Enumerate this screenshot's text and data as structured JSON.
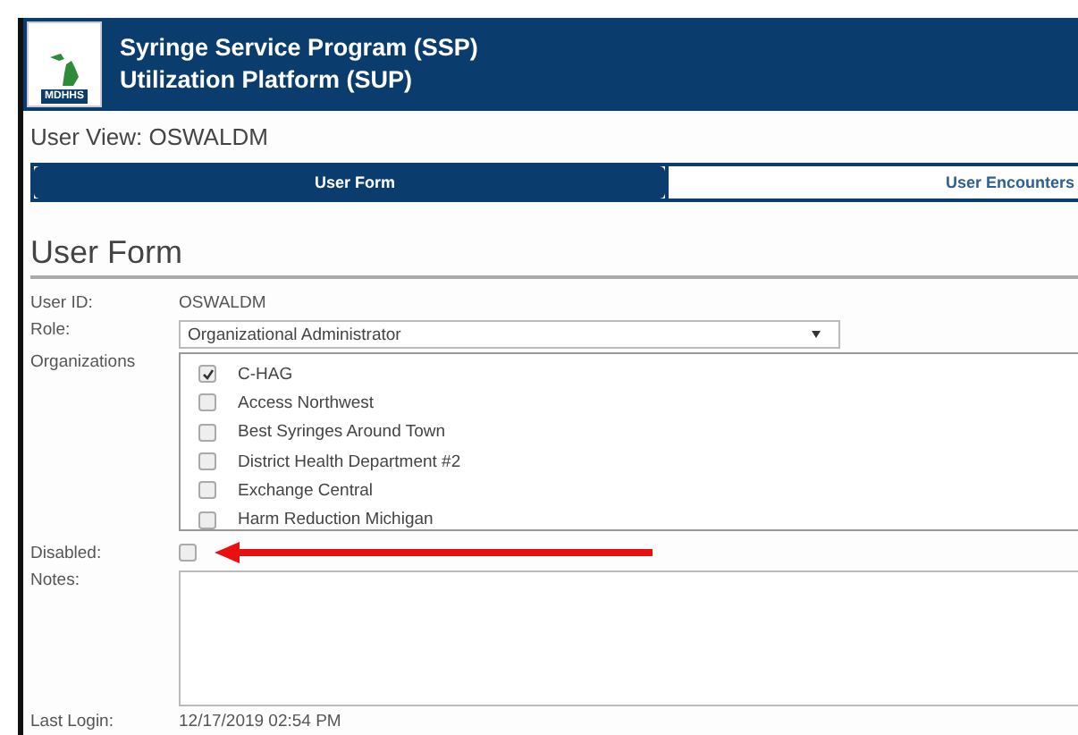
{
  "header": {
    "logo_text": "MDHHS",
    "title_lines": [
      "Syringe Service Program (SSP)",
      "Utilization Platform (SUP)"
    ]
  },
  "view_title": "User View: OSWALDM",
  "tabs": [
    {
      "label": "User Form",
      "selected": true
    },
    {
      "label": "User Encounters",
      "selected": false
    }
  ],
  "form": {
    "heading": "User Form",
    "user_id": {
      "label": "User ID:",
      "value": "OSWALDM"
    },
    "role": {
      "label": "Role:",
      "value": "Organizational Administrator"
    },
    "organizations": {
      "label": "Organizations",
      "items": [
        {
          "name": "C-HAG",
          "checked": true
        },
        {
          "name": "Access Northwest",
          "checked": false
        },
        {
          "name": "Best Syringes Around Town",
          "checked": false
        },
        {
          "name": "District Health Department #2",
          "checked": false
        },
        {
          "name": "Exchange Central",
          "checked": false
        },
        {
          "name": "Harm Reduction Michigan",
          "checked": false
        }
      ]
    },
    "disabled": {
      "label": "Disabled:",
      "checked": false
    },
    "notes": {
      "label": "Notes:"
    },
    "last_login": {
      "label": "Last Login:",
      "value": "12/17/2019 02:54 PM"
    }
  }
}
